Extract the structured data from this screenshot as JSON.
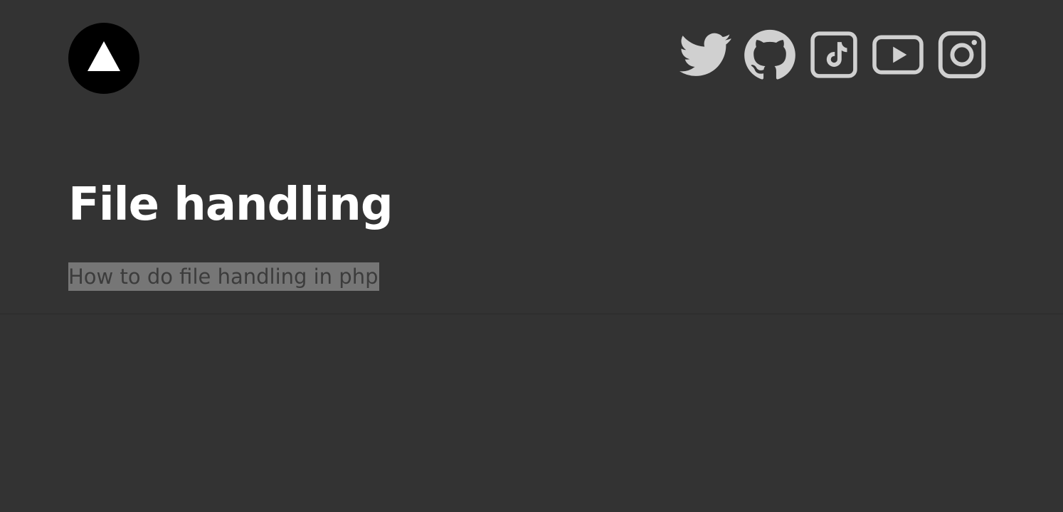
{
  "site": {
    "logo_icon": "triangle-logo-icon"
  },
  "social_links": [
    {
      "name": "twitter",
      "icon": "twitter-icon"
    },
    {
      "name": "github",
      "icon": "github-icon"
    },
    {
      "name": "tiktok",
      "icon": "tiktok-icon"
    },
    {
      "name": "youtube",
      "icon": "youtube-icon"
    },
    {
      "name": "instagram",
      "icon": "instagram-icon"
    }
  ],
  "hero": {
    "title": "File handling",
    "subtitle": "How to do file handling in php"
  },
  "colors": {
    "background": "#333333",
    "title": "#ffffff",
    "subtitle_text": "#3c3c3c",
    "subtitle_highlight": "#767676",
    "icons": "#d0d0d0",
    "logo_bg": "#000000"
  }
}
